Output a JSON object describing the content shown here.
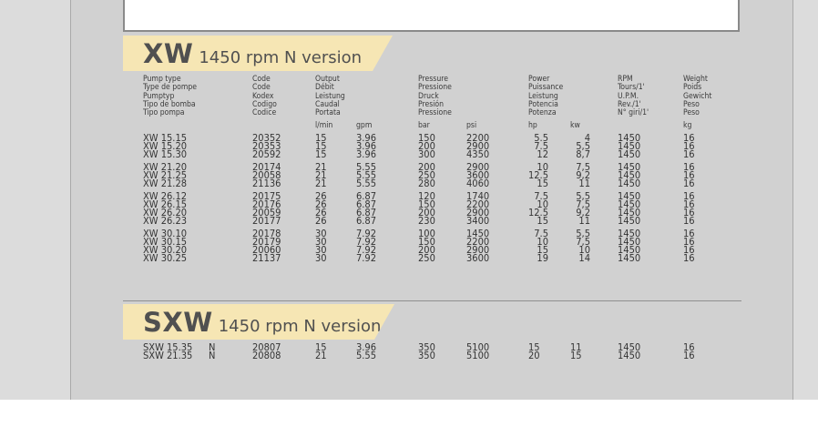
{
  "xw_banner": {
    "model": "XW",
    "subtitle": "1450 rpm N version"
  },
  "sxw_banner": {
    "model": "SXW",
    "subtitle": "1450 rpm N version"
  },
  "headers": {
    "pump_type": "Pump type\nType de pompe\nPumptyp\nTipo de bomba\nTipo pompa",
    "code": "Code\nCode\nKodex\nCodigo\nCodice",
    "output": "Output\nDébit\nLeistung\nCaudal\nPortata",
    "pressure": "Pressure\nPressione\nDruck\nPresión\nPressione",
    "power": "Power\nPuissance\nLeistung\nPotencia\nPotenza",
    "rpm": "RPM\nTours/1'\nU.P.M.\nRev./1'\nN° giri/1'",
    "weight": "Weight\nPoids\nGewicht\nPeso\nPeso"
  },
  "units": {
    "lmin": "l/min",
    "gpm": "gpm",
    "bar": "bar",
    "psi": "psi",
    "hp": "hp",
    "kw": "kw",
    "kg": "kg"
  },
  "xw_groups": [
    [
      [
        "XW 15.15",
        "20352",
        "15",
        "3.96",
        "150",
        "2200",
        "5.5",
        "4",
        "1450",
        "16"
      ],
      [
        "XW 15.20",
        "20353",
        "15",
        "3.96",
        "200",
        "2900",
        "7.5",
        "5,5",
        "1450",
        "16"
      ],
      [
        "XW 15.30",
        "20592",
        "15",
        "3.96",
        "300",
        "4350",
        "12",
        "8,7",
        "1450",
        "16"
      ]
    ],
    [
      [
        "XW 21.20",
        "20174",
        "21",
        "5.55",
        "200",
        "2900",
        "10",
        "7,5",
        "1450",
        "16"
      ],
      [
        "XW 21.25",
        "20058",
        "21",
        "5.55",
        "250",
        "3600",
        "12.5",
        "9,2",
        "1450",
        "16"
      ],
      [
        "XW 21.28",
        "21136",
        "21",
        "5.55",
        "280",
        "4060",
        "15",
        "11",
        "1450",
        "16"
      ]
    ],
    [
      [
        "XW 26.12",
        "20175",
        "26",
        "6.87",
        "120",
        "1740",
        "7.5",
        "5,5",
        "1450",
        "16"
      ],
      [
        "XW 26.15",
        "20176",
        "26",
        "6.87",
        "150",
        "2200",
        "10",
        "7,5",
        "1450",
        "16"
      ],
      [
        "XW 26.20",
        "20059",
        "26",
        "6.87",
        "200",
        "2900",
        "12.5",
        "9,2",
        "1450",
        "16"
      ],
      [
        "XW 26.23",
        "20177",
        "26",
        "6.87",
        "230",
        "3400",
        "15",
        "11",
        "1450",
        "16"
      ]
    ],
    [
      [
        "XW 30.10",
        "20178",
        "30",
        "7.92",
        "100",
        "1450",
        "7.5",
        "5,5",
        "1450",
        "16"
      ],
      [
        "XW 30.15",
        "20179",
        "30",
        "7.92",
        "150",
        "2200",
        "10",
        "7,5",
        "1450",
        "16"
      ],
      [
        "XW 30.20",
        "20060",
        "30",
        "7.92",
        "200",
        "2900",
        "15",
        "10",
        "1450",
        "16"
      ],
      [
        "XW 30.25",
        "21137",
        "30",
        "7.92",
        "250",
        "3600",
        "19",
        "14",
        "1450",
        "16"
      ]
    ]
  ],
  "sxw_rows": [
    [
      "SXW 15.35",
      "N",
      "20807",
      "15",
      "3.96",
      "350",
      "5100",
      "15",
      "11",
      "1450",
      "16"
    ],
    [
      "SXW 21.35",
      "N",
      "20808",
      "21",
      "5.55",
      "350",
      "5100",
      "20",
      "15",
      "1450",
      "16"
    ]
  ]
}
